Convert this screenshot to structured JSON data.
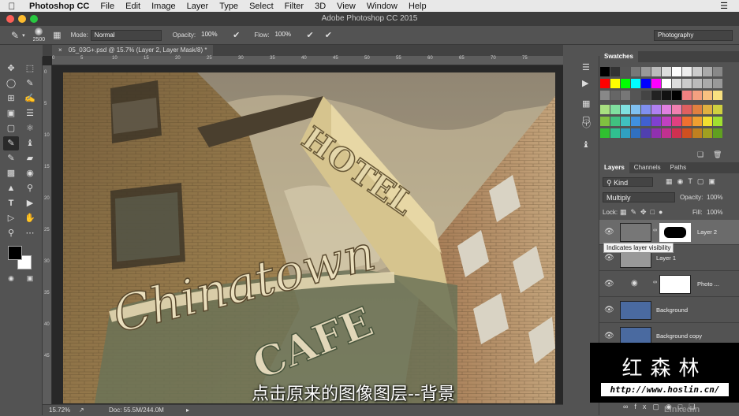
{
  "menubar": {
    "app": "Photoshop CC",
    "items": [
      "File",
      "Edit",
      "Image",
      "Layer",
      "Type",
      "Select",
      "Filter",
      "3D",
      "View",
      "Window",
      "Help"
    ]
  },
  "window": {
    "title": "Adobe Photoshop CC 2015"
  },
  "options": {
    "brush_size": "2500",
    "mode_label": "Mode:",
    "mode_value": "Normal",
    "opacity_label": "Opacity:",
    "opacity_value": "100%",
    "flow_label": "Flow:",
    "flow_value": "100%",
    "workspace": "Photography"
  },
  "document": {
    "tab": "05_03G+.psd @ 15.7% (Layer 2, Layer Mask/8) *"
  },
  "ruler_h": [
    "0",
    "5",
    "10",
    "15",
    "20",
    "25",
    "30",
    "35",
    "40",
    "45",
    "50",
    "55",
    "60",
    "65",
    "70",
    "75"
  ],
  "ruler_v": [
    "0",
    "5",
    "10",
    "15",
    "20",
    "25",
    "30",
    "35",
    "40",
    "45"
  ],
  "status": {
    "zoom": "15.72%",
    "doc": "Doc: 55.5M/244.0M"
  },
  "subtitle": "点击原来的图像图层--背景",
  "swatches": {
    "title": "Swatches"
  },
  "layers_panel": {
    "tabs": [
      "Layers",
      "Channels",
      "Paths"
    ],
    "filter": "Kind",
    "blend_mode": "Multiply",
    "opacity_label": "Opacity:",
    "opacity_value": "100%",
    "lock_label": "Lock:",
    "fill_label": "Fill:",
    "fill_value": "100%",
    "layers": [
      {
        "name": "Layer 2"
      },
      {
        "name": "Layer 1"
      },
      {
        "name": "Photo ..."
      },
      {
        "name": "Background"
      },
      {
        "name": "Background copy"
      }
    ],
    "tooltip": "Indicates layer visibility"
  },
  "watermark": {
    "text": "红森林",
    "url": "http://www.hoslin.cn/",
    "brand": "Linkedin"
  },
  "colors": {
    "menubar": "#e8e8e8",
    "panel": "#535353",
    "canvas_bg": "#282828",
    "accent": "#4a90d9"
  }
}
